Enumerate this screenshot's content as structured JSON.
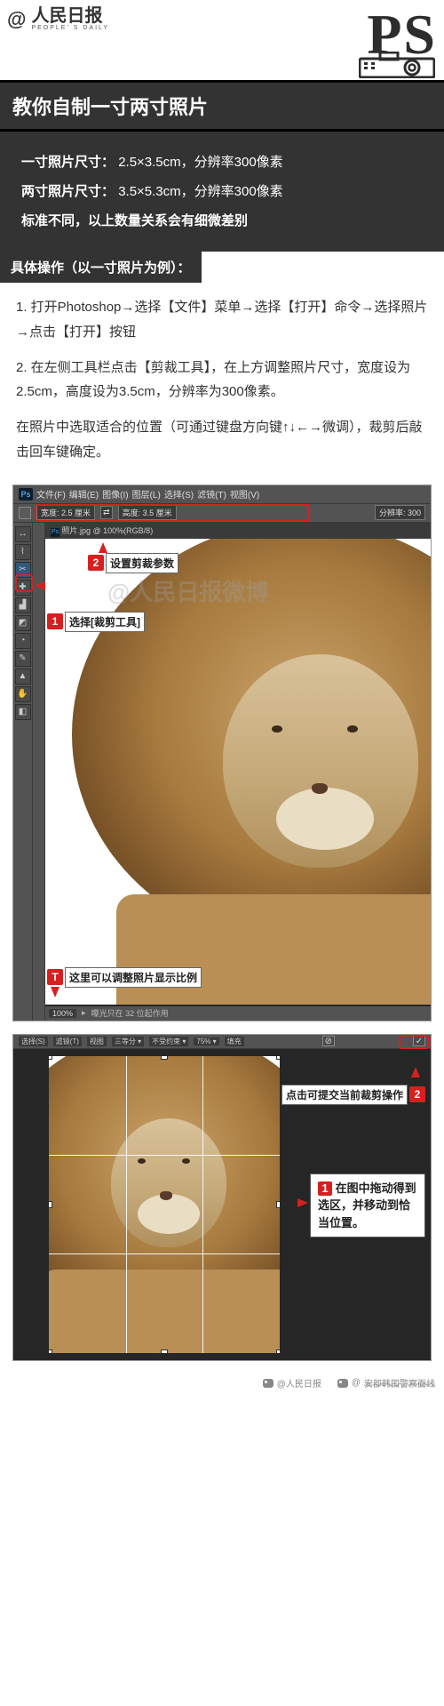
{
  "header": {
    "at": "@",
    "masthead_cn": "人民日报",
    "masthead_en": "PEOPLE' S DAILY",
    "ps_logo": "PS"
  },
  "title": "教你自制一寸两寸照片",
  "intro": {
    "line1_label": "一寸照片尺寸：",
    "line1_value": "2.5×3.5cm，分辨率300像素",
    "line2_label": "两寸照片尺寸：",
    "line2_value": "3.5×5.3cm，分辨率300像素",
    "note": "标准不同，以上数量关系会有细微差别"
  },
  "section_heading": "具体操作（以一寸照片为例）：",
  "steps": {
    "s1": "1. 打开Photoshop→选择【文件】菜单→选择【打开】命令→选择照片→点击【打开】按钮",
    "s2": "2. 在左侧工具栏点击【剪裁工具】，在上方调整照片尺寸，宽度设为2.5cm，高度设为3.5cm，分辨率为300像素。",
    "s3": "在照片中选取适合的位置（可通过键盘方向键↑↓←→微调），裁剪后敲击回车键确定。"
  },
  "ps1": {
    "badge": "Ps",
    "menus": [
      "文件(F)",
      "编辑(E)",
      "图像(I)",
      "图层(L)",
      "选择(S)",
      "滤镜(T)",
      "视图(V)"
    ],
    "opt_width_label": "宽度:",
    "opt_width_value": "2.5 厘米",
    "opt_height_label": "高度:",
    "opt_height_value": "3.5 厘米",
    "opt_res_label": "分辨率:",
    "opt_res_value": "300",
    "doc_tab": "照片.jpg @ 100%(RGB/8)",
    "zoom": "100%",
    "status_msg": "曝光只在 32 位起作用",
    "watermark": "@人民日报微博",
    "callout1_num": "1",
    "callout1_text": "选择[裁剪工具]",
    "callout2_num": "2",
    "callout2_text": "设置剪裁参数",
    "calloutT_num": "T",
    "calloutT_text": "这里可以调整照片显示比例",
    "tool_glyphs": [
      "▭",
      "▦",
      "◧",
      "⊕",
      "✂",
      "✎",
      "✦",
      "⬚",
      "◐",
      "T",
      "▲",
      "✥",
      "⊞",
      "❐",
      "◧"
    ]
  },
  "ps2": {
    "toolbar_items": [
      "选择(S)",
      "滤镜(T)",
      "视图",
      "三等分 ▾",
      "",
      "不受约束 ▾",
      "75% ▾",
      "填充"
    ],
    "commit_glyph": "✓",
    "cancel_glyph": "⊘",
    "callout1_num": "1",
    "callout1_text": "在图中拖动得到选区，并移动到恰当位置。",
    "callout2_num": "2",
    "callout2_text": "点击可提交当前裁剪操作"
  },
  "footer": {
    "weibo_icon": "weibo",
    "left": "@人民日报",
    "right_prefix": "@",
    "right_text": "安部韩国警察面线"
  }
}
